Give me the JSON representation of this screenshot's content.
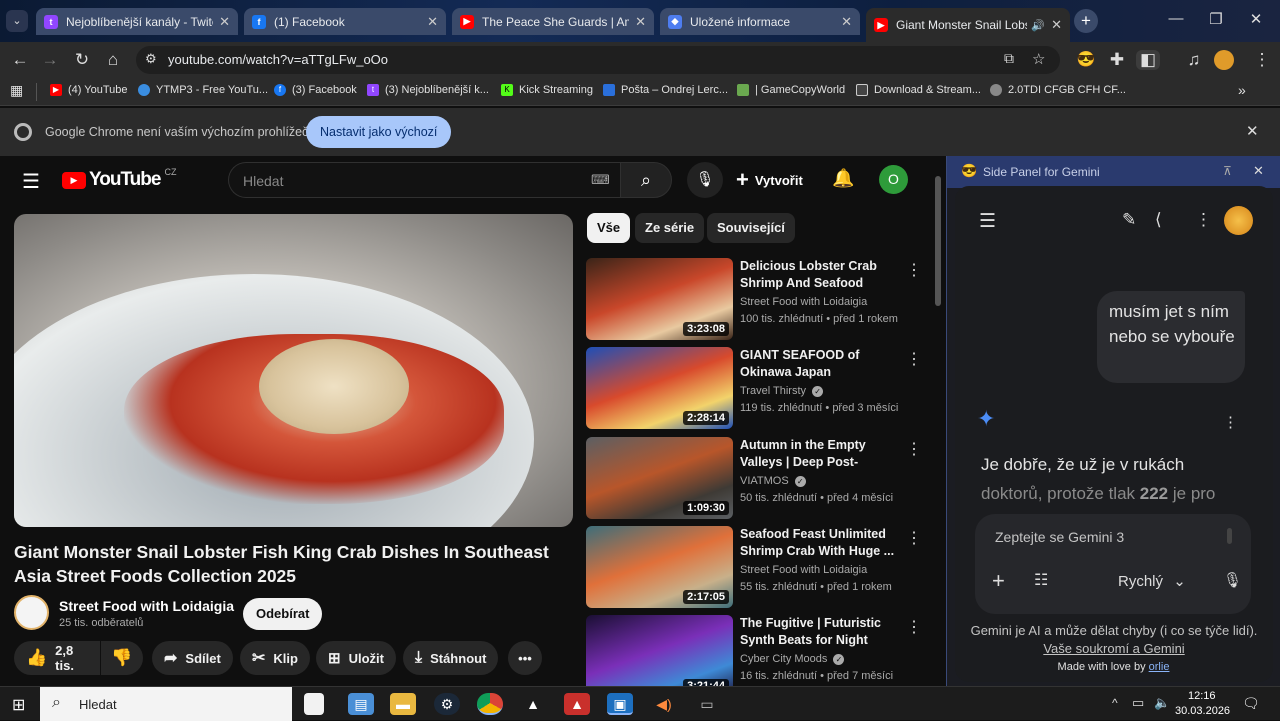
{
  "tabs": [
    {
      "title": "Nejoblíbenější kanály - Twitch",
      "icon": "twitch-icon",
      "color": "#9146ff"
    },
    {
      "title": "(1) Facebook",
      "icon": "facebook-icon",
      "color": "#1877f2"
    },
    {
      "title": "The Peace She Guards | Ambien",
      "icon": "youtube-icon",
      "color": "#ff0000"
    },
    {
      "title": "Uložené informace",
      "icon": "gemini-icon",
      "color": "#4e7df0"
    },
    {
      "title": "Giant Monster Snail Lobster",
      "icon": "youtube-icon",
      "color": "#ff0000"
    }
  ],
  "toolbar": {
    "url": "youtube.com/watch?v=aTTgLFw_oOo"
  },
  "bookmarks": [
    {
      "label": "(4) YouTube",
      "color": "#ff0000"
    },
    {
      "label": "YTMP3 - Free YouTu...",
      "color": "#3a8de0"
    },
    {
      "label": "(3) Facebook",
      "color": "#1877f2"
    },
    {
      "label": "(3) Nejoblíbenější k...",
      "color": "#9146ff"
    },
    {
      "label": "Kick Streaming",
      "color": "#53fc18"
    },
    {
      "label": "Pošta – Ondrej Lerc...",
      "color": "#2a6fdb"
    },
    {
      "label": "| GameCopyWorld",
      "color": "#6aa84f"
    },
    {
      "label": "Download & Stream...",
      "color": "#cccccc"
    },
    {
      "label": "2.0TDI CFGB CFH CF...",
      "color": "#bbbbbb"
    }
  ],
  "infobar": {
    "message": "Google Chrome není vaším výchozím prohlížečem",
    "button": "Nastavit jako výchozí"
  },
  "youtube": {
    "logo": "YouTube",
    "country": "CZ",
    "search_placeholder": "Hledat",
    "create_label": "Vytvořit",
    "avatar_letter": "O",
    "chips": [
      "Vše",
      "Ze série",
      "Související"
    ],
    "video_title": "Giant Monster Snail Lobster Fish King Crab Dishes In Southeast Asia Street Foods Collection 2025",
    "channel_name": "Street Food with Loidaigia",
    "subscribers": "25 tis. odběratelů",
    "subscribe_label": "Odebírat",
    "likes": "2,8 tis.",
    "share_label": "Sdílet",
    "clip_label": "Klip",
    "save_label": "Uložit",
    "download_label": "Stáhnout",
    "recommendations": [
      {
        "title": "Delicious Lobster Crab Shrimp And Seafood Dishe...",
        "channel": "Street Food with Loidaigia",
        "meta": "100 tis. zhlédnutí • před 1 rokem",
        "duration": "3:23:08",
        "verified": false,
        "colors": [
          "#3a2418",
          "#c9472a",
          "#e8c9a0"
        ]
      },
      {
        "title": "GIANT SEAFOOD of Okinawa Japan",
        "channel": "Travel Thirsty",
        "meta": "119 tis. zhlédnutí • před 3 měsíci",
        "duration": "2:28:14",
        "verified": true,
        "colors": [
          "#1d4fb8",
          "#d84a2c",
          "#f2d36b"
        ]
      },
      {
        "title": "Autumn in the Empty Valleys | Deep Post-Apocalyptic ...",
        "channel": "VIATMOS",
        "meta": "50 tis. zhlédnutí • před 4 měsíci",
        "duration": "1:09:30",
        "verified": true,
        "colors": [
          "#5b5f63",
          "#b8562a",
          "#3e3a35"
        ]
      },
      {
        "title": "Seafood Feast Unlimited Shrimp Crab With Huge ...",
        "channel": "Street Food with Loidaigia",
        "meta": "55 tis. zhlédnutí • před 1 rokem",
        "duration": "2:17:05",
        "verified": false,
        "colors": [
          "#3d6e7a",
          "#e0703a",
          "#c8b08a"
        ]
      },
      {
        "title": "The Fugitive | Futuristic Synth Beats for Night Drive...",
        "channel": "Cyber City Moods",
        "meta": "16 tis. zhlédnutí • před 7 měsíci",
        "duration": "3:21:44",
        "verified": true,
        "colors": [
          "#1a0f33",
          "#7a2fb8",
          "#3e8ad6"
        ]
      }
    ]
  },
  "gemini": {
    "header": "Side Panel for Gemini",
    "user_message": "musím jet s ním nebo se vybouře",
    "reply_line1": "Je dobře, že už je v rukách",
    "reply_line2_a": "doktorů, protože tlak ",
    "reply_line2_bold": "222",
    "reply_line2_b": " je pro",
    "input_placeholder": "Zeptejte se Gemini 3",
    "mode_label": "Rychlý",
    "disclaimer": "Gemini je AI a může dělat chyby (i co se týče lidí).",
    "privacy_link": "Vaše soukromí a Gemini",
    "made_with_love": "Made with love by",
    "author": "orlie"
  },
  "taskbar": {
    "search_placeholder": "Hledat",
    "time": "12:16",
    "date": "30.03.2026"
  }
}
